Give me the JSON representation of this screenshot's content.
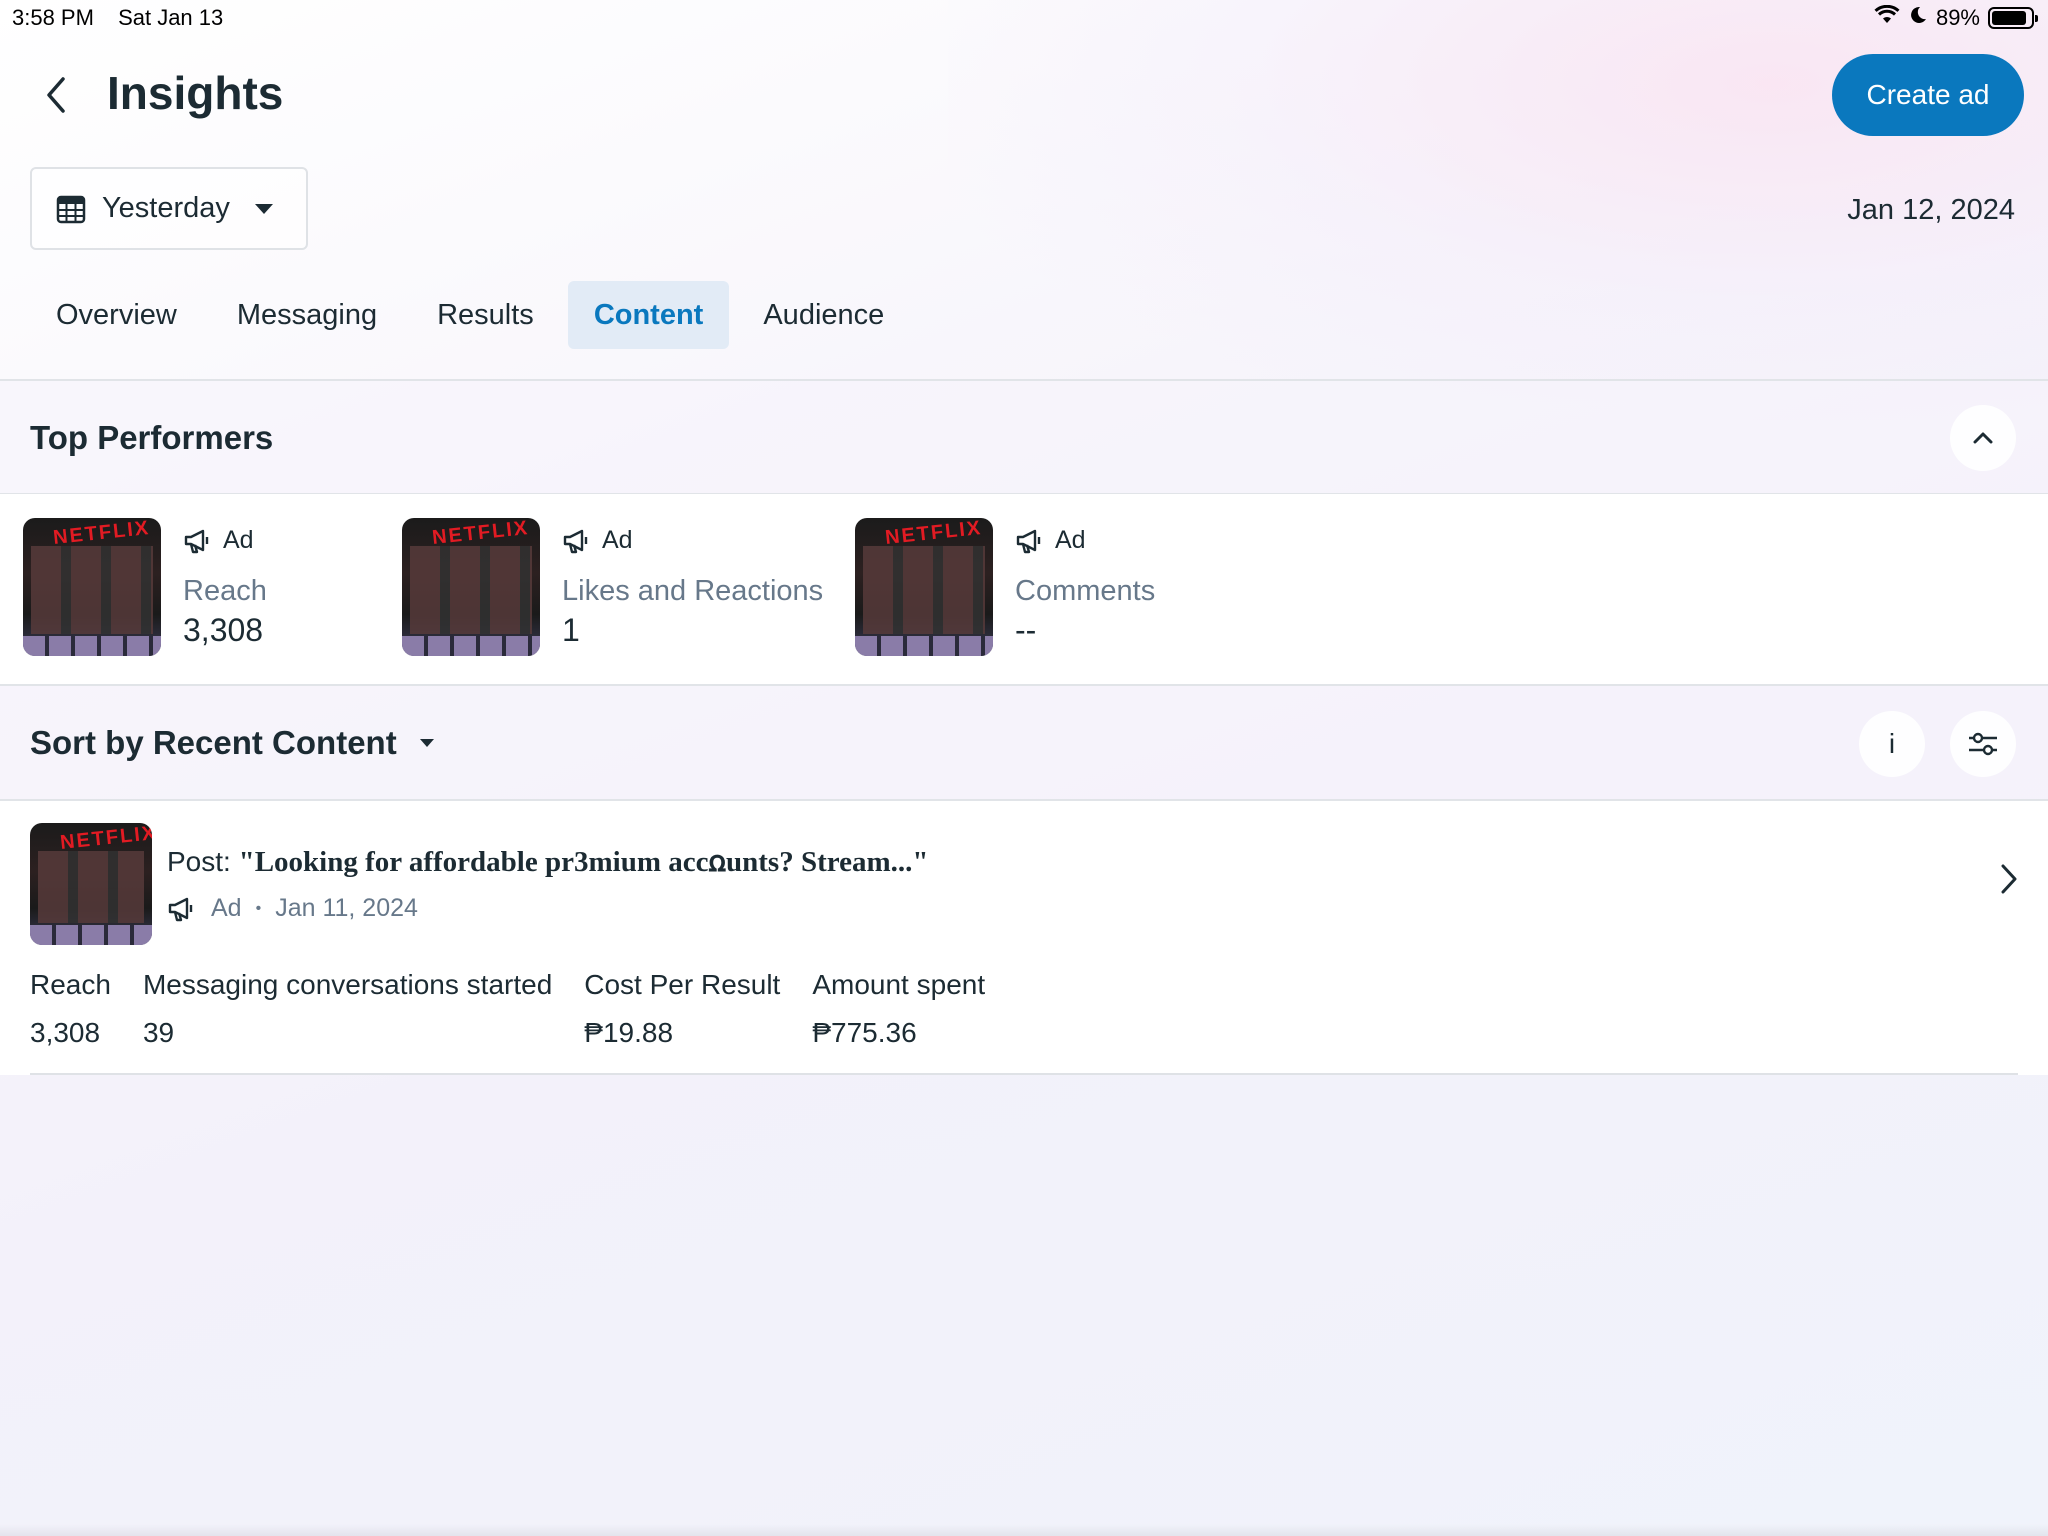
{
  "status_bar": {
    "time": "3:58 PM",
    "date": "Sat Jan 13",
    "battery": "89%",
    "battery_level": 0.89
  },
  "header": {
    "title": "Insights",
    "create_ad_label": "Create ad"
  },
  "date_filter": {
    "selected": "Yesterday",
    "date_label": "Jan 12, 2024"
  },
  "tabs": [
    {
      "label": "Overview",
      "active": false
    },
    {
      "label": "Messaging",
      "active": false
    },
    {
      "label": "Results",
      "active": false
    },
    {
      "label": "Content",
      "active": true
    },
    {
      "label": "Audience",
      "active": false
    }
  ],
  "top_performers": {
    "title": "Top Performers",
    "items": [
      {
        "type": "Ad",
        "metric": "Reach",
        "value": "3,308",
        "thumb_logo": "NETFLIX"
      },
      {
        "type": "Ad",
        "metric": "Likes and Reactions",
        "value": "1",
        "thumb_logo": "NETFLIX"
      },
      {
        "type": "Ad",
        "metric": "Comments",
        "value": "--",
        "thumb_logo": "NETFLIX"
      }
    ]
  },
  "sort": {
    "label": "Sort by Recent Content",
    "info_label": "i"
  },
  "content": {
    "post_prefix": "Post: ",
    "post_quote": "\"Looking for affordable pr3mium accꭥunts? Stream...\"",
    "type": "Ad",
    "separator": "•",
    "date": "Jan 11, 2024",
    "thumb_logo": "NETFLIX",
    "stats": [
      {
        "label": "Reach",
        "value": "3,308"
      },
      {
        "label": "Messaging conversations started",
        "value": "39"
      },
      {
        "label": "Cost Per Result",
        "value": "₱19.88"
      },
      {
        "label": "Amount spent",
        "value": "₱775.36"
      }
    ]
  },
  "icons": {
    "back": "chevron-left-icon",
    "calendar": "calendar-icon",
    "dropdown": "caret-down-icon",
    "collapse": "chevron-up-icon",
    "megaphone": "megaphone-icon",
    "filter": "sliders-icon",
    "forward": "chevron-right-icon"
  },
  "colors": {
    "accent": "#0a78be",
    "active_tab_bg": "#e2ebf6",
    "text": "#1c2b33",
    "muted": "#67788a"
  }
}
